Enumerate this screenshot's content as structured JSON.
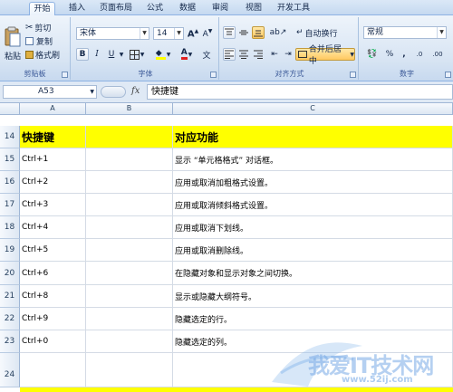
{
  "ribbon_tabs": [
    "开始",
    "插入",
    "页面布局",
    "公式",
    "数据",
    "审阅",
    "视图",
    "开发工具"
  ],
  "clipboard": {
    "paste": "粘贴",
    "cut": "剪切",
    "copy": "复制",
    "format_painter": "格式刷",
    "label": "剪贴板"
  },
  "font": {
    "name": "宋体",
    "size": "14",
    "label": "字体",
    "bold": "B",
    "italic": "I",
    "underline": "U"
  },
  "alignment": {
    "wrap_text": "自动换行",
    "merge_center": "合并后居中",
    "label": "对齐方式"
  },
  "number": {
    "format": "常规",
    "label": "数字",
    "percent": "%",
    "comma": ",",
    "decimal_inc": ".0",
    "decimal_dec": ".00"
  },
  "formula_bar": {
    "cell_ref": "A53",
    "fx": "fx",
    "content": "快捷键"
  },
  "columns": [
    "A",
    "B",
    "C"
  ],
  "header_row": {
    "num": "14",
    "a": "快捷键",
    "c": "对应功能"
  },
  "rows": [
    {
      "num": "15",
      "a": "Ctrl+1",
      "c": "显示 “单元格格式” 对话框。"
    },
    {
      "num": "16",
      "a": "Ctrl+2",
      "c": "应用或取消加粗格式设置。"
    },
    {
      "num": "17",
      "a": "Ctrl+3",
      "c": "应用或取消倾斜格式设置。"
    },
    {
      "num": "18",
      "a": "Ctrl+4",
      "c": "应用或取消下划线。"
    },
    {
      "num": "19",
      "a": "Ctrl+5",
      "c": "应用或取消删除线。"
    },
    {
      "num": "20",
      "a": "Ctrl+6",
      "c": "在隐藏对象和显示对象之间切换。"
    },
    {
      "num": "21",
      "a": "Ctrl+8",
      "c": "显示或隐藏大纲符号。"
    },
    {
      "num": "22",
      "a": "Ctrl+9",
      "c": "隐藏选定的行。"
    },
    {
      "num": "23",
      "a": "Ctrl+0",
      "c": "隐藏选定的列。"
    },
    {
      "num": "24",
      "a": "",
      "c": ""
    }
  ],
  "watermark": {
    "text": "我爱IT技术网",
    "url": "www.52ij.com"
  },
  "colors": {
    "header_fill": "#ffff00",
    "ribbon_border": "#8db2e3",
    "font_color_red": "#e02020",
    "fill_yellow": "#ffff00"
  }
}
